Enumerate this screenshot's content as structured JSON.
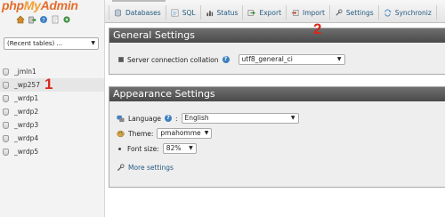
{
  "logo": {
    "php": "php",
    "my": "My",
    "admin": "Admin"
  },
  "nav": {
    "quick_icons": [
      "home-icon",
      "exit-icon",
      "help-icon",
      "docs-icon",
      "settings-icon"
    ],
    "recent_tables": {
      "value": "(Recent tables) ..."
    },
    "databases": [
      {
        "name": "_jmln1",
        "active": false
      },
      {
        "name": "_wp257",
        "active": true
      },
      {
        "name": "_wrdp1",
        "active": false
      },
      {
        "name": "_wrdp2",
        "active": false
      },
      {
        "name": "_wrdp3",
        "active": false
      },
      {
        "name": "_wrdp4",
        "active": false
      },
      {
        "name": "_wrdp5",
        "active": false
      }
    ]
  },
  "annotations": {
    "marker_1": "1",
    "marker_2": "2",
    "color": "#d9281d"
  },
  "tabs": [
    {
      "label": "Databases",
      "icon": "databases-icon"
    },
    {
      "label": "SQL",
      "icon": "sql-icon"
    },
    {
      "label": "Status",
      "icon": "status-icon"
    },
    {
      "label": "Export",
      "icon": "export-icon"
    },
    {
      "label": "Import",
      "icon": "import-icon"
    },
    {
      "label": "Settings",
      "icon": "settings-icon"
    },
    {
      "label": "Synchroniz",
      "icon": "synchronize-icon"
    }
  ],
  "general_settings": {
    "title": "General Settings",
    "collation_label": "Server connection collation",
    "collation_value": "utf8_general_ci"
  },
  "appearance_settings": {
    "title": "Appearance Settings",
    "language_label": "Language",
    "language_value": "English",
    "theme_label": "Theme:",
    "theme_value": "pmahomme",
    "font_size_label": "Font size:",
    "font_size_value": "82%",
    "more_settings": "More settings"
  },
  "colors": {
    "logo_orange": "#e36e2c",
    "panel_header": "#555555",
    "link_blue": "#235a81"
  }
}
